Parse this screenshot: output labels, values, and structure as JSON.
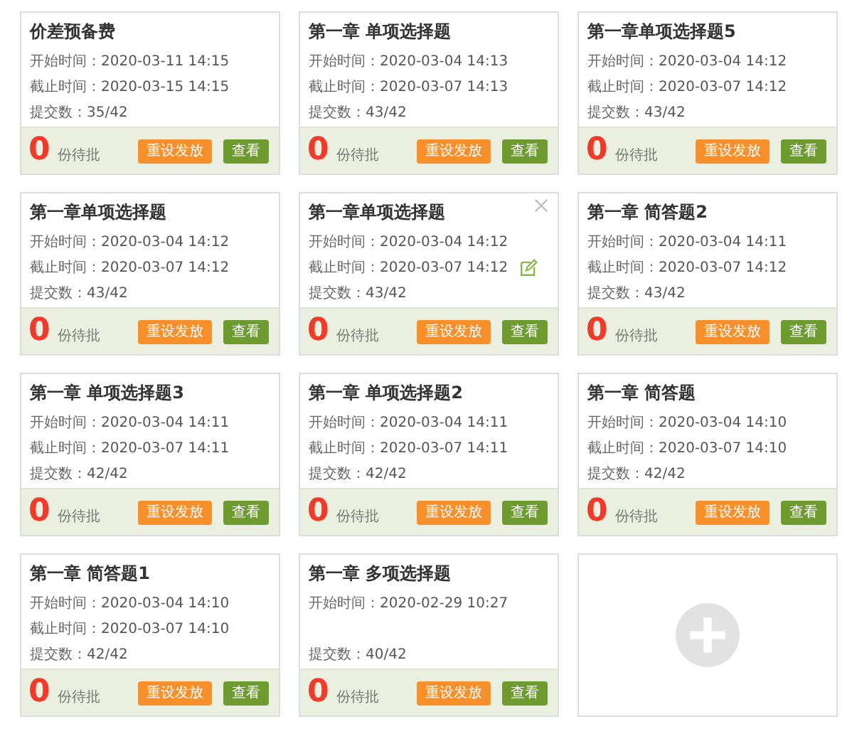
{
  "cards": [
    {
      "title": "价差预备费",
      "start_label": "开始时间：",
      "start": "2020-03-11 14:15",
      "end_label": "截止时间：",
      "end": "2020-03-15 14:15",
      "count_label": "提交数：",
      "count": "35/42",
      "pending": "0",
      "pending_label": "份待批",
      "reset_button": "重设发放",
      "view_button": "查看",
      "hovered": false
    },
    {
      "title": "第一章 单项选择题",
      "start_label": "开始时间：",
      "start": "2020-03-04 14:13",
      "end_label": "截止时间：",
      "end": "2020-03-07 14:13",
      "count_label": "提交数：",
      "count": "43/42",
      "pending": "0",
      "pending_label": "份待批",
      "reset_button": "重设发放",
      "view_button": "查看",
      "hovered": false
    },
    {
      "title": "第一章单项选择题5",
      "start_label": "开始时间：",
      "start": "2020-03-04 14:12",
      "end_label": "截止时间：",
      "end": "2020-03-07 14:12",
      "count_label": "提交数：",
      "count": "43/42",
      "pending": "0",
      "pending_label": "份待批",
      "reset_button": "重设发放",
      "view_button": "查看",
      "hovered": false
    },
    {
      "title": "第一章单项选择题",
      "start_label": "开始时间：",
      "start": "2020-03-04 14:12",
      "end_label": "截止时间：",
      "end": "2020-03-07 14:12",
      "count_label": "提交数：",
      "count": "43/42",
      "pending": "0",
      "pending_label": "份待批",
      "reset_button": "重设发放",
      "view_button": "查看",
      "hovered": false
    },
    {
      "title": "第一章单项选择题",
      "start_label": "开始时间：",
      "start": "2020-03-04 14:12",
      "end_label": "截止时间：",
      "end": "2020-03-07 14:12",
      "count_label": "提交数：",
      "count": "43/42",
      "pending": "0",
      "pending_label": "份待批",
      "reset_button": "重设发放",
      "view_button": "查看",
      "hovered": true
    },
    {
      "title": "第一章 简答题2",
      "start_label": "开始时间：",
      "start": "2020-03-04 14:11",
      "end_label": "截止时间：",
      "end": "2020-03-07 14:12",
      "count_label": "提交数：",
      "count": "43/42",
      "pending": "0",
      "pending_label": "份待批",
      "reset_button": "重设发放",
      "view_button": "查看",
      "hovered": false
    },
    {
      "title": "第一章 单项选择题3",
      "start_label": "开始时间：",
      "start": "2020-03-04 14:11",
      "end_label": "截止时间：",
      "end": "2020-03-07 14:11",
      "count_label": "提交数：",
      "count": "42/42",
      "pending": "0",
      "pending_label": "份待批",
      "reset_button": "重设发放",
      "view_button": "查看",
      "hovered": false
    },
    {
      "title": "第一章 单项选择题2",
      "start_label": "开始时间：",
      "start": "2020-03-04 14:11",
      "end_label": "截止时间：",
      "end": "2020-03-07 14:11",
      "count_label": "提交数：",
      "count": "42/42",
      "pending": "0",
      "pending_label": "份待批",
      "reset_button": "重设发放",
      "view_button": "查看",
      "hovered": false
    },
    {
      "title": "第一章 简答题",
      "start_label": "开始时间：",
      "start": "2020-03-04 14:10",
      "end_label": "截止时间：",
      "end": "2020-03-07 14:10",
      "count_label": "提交数：",
      "count": "42/42",
      "pending": "0",
      "pending_label": "份待批",
      "reset_button": "重设发放",
      "view_button": "查看",
      "hovered": false
    },
    {
      "title": "第一章 简答题1",
      "start_label": "开始时间：",
      "start": "2020-03-04 14:10",
      "end_label": "截止时间：",
      "end": "2020-03-07 14:10",
      "count_label": "提交数：",
      "count": "42/42",
      "pending": "0",
      "pending_label": "份待批",
      "reset_button": "重设发放",
      "view_button": "查看",
      "hovered": false
    },
    {
      "title": "第一章 多项选择题",
      "start_label": "开始时间：",
      "start": "2020-02-29 10:27",
      "count_label": "提交数：",
      "count": "40/42",
      "pending": "0",
      "pending_label": "份待批",
      "reset_button": "重设发放",
      "view_button": "查看",
      "hovered": false
    }
  ]
}
